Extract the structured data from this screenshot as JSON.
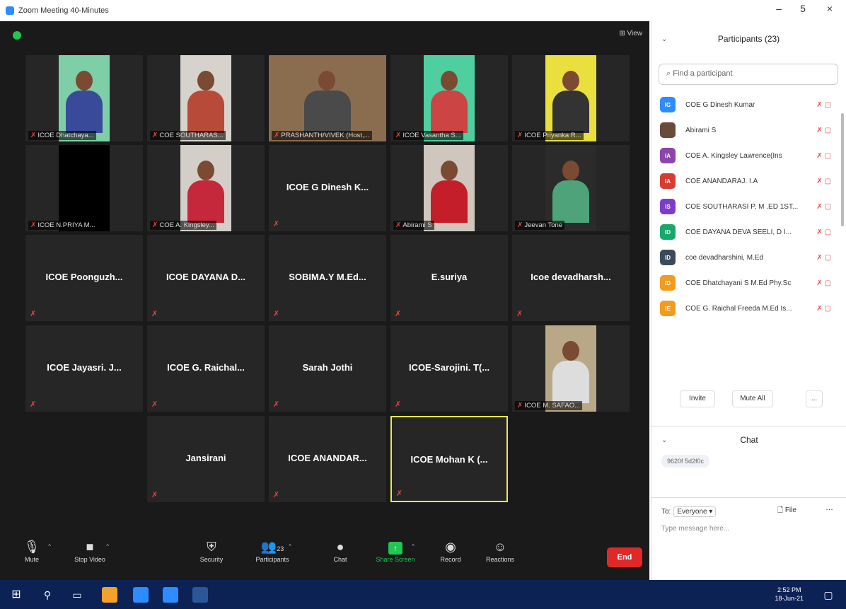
{
  "window": {
    "title": "Zoom Meeting 40-Minutes",
    "min": "–",
    "max": "5",
    "close": "×"
  },
  "meeting": {
    "view_label": "View"
  },
  "tiles": [
    {
      "label": "ICOE Dhatchaya...",
      "photo": true,
      "bg": "#7ecfa7",
      "shirt": "#3a4a9a"
    },
    {
      "label": "COE SOUTHARAS...",
      "photo": true,
      "bg": "#d7d3cc",
      "shirt": "#b84a3a"
    },
    {
      "label": "PRASHANTH/VIVEK (Host,...",
      "photo": true,
      "bg": "#8a6d4f",
      "shirt": "#4a4a4a",
      "wide": true
    },
    {
      "label": "ICOE Vasantha S...",
      "photo": true,
      "bg": "#4fcf9f",
      "shirt": "#c44"
    },
    {
      "label": "ICOE Priyanka R...",
      "photo": true,
      "bg": "#e9e040",
      "shirt": "#333"
    },
    {
      "label": "ICOE N.PRIYA M...",
      "photo": true,
      "bg": "#000",
      "shirt": "#000"
    },
    {
      "label": "COE A. Kingsley...",
      "photo": true,
      "bg": "#d3cfc8",
      "shirt": "#c4283a"
    },
    {
      "name": "ICOE G Dinesh K..."
    },
    {
      "label": "Abirami S",
      "photo": true,
      "bg": "#cfc6bd",
      "shirt": "#c41e2a"
    },
    {
      "label": "Jeevan Tone",
      "photo": true,
      "bg": "#2b2b2b",
      "shirt": "#4fa37a"
    },
    {
      "name": "ICOE Poonguzh..."
    },
    {
      "name": "ICOE DAYANA D..."
    },
    {
      "name": "SOBIMA.Y M.Ed..."
    },
    {
      "name": "E.suriya"
    },
    {
      "name": "Icoe devadharsh..."
    },
    {
      "name": "ICOE Jayasri. J..."
    },
    {
      "name": "ICOE G. Raichal..."
    },
    {
      "name": "Sarah Jothi"
    },
    {
      "name": "ICOE-Sarojini. T(..."
    },
    {
      "label": "ICOE M. SAFAO...",
      "photo": true,
      "bg": "#b9a888",
      "shirt": "#ddd"
    },
    {
      "name": "Jansirani"
    },
    {
      "name": "ICOE ANANDAR..."
    },
    {
      "name": "ICOE Mohan K (..."
    }
  ],
  "toolbar": {
    "mute": "Mute",
    "video": "Stop Video",
    "security": "Security",
    "participants": "Participants",
    "participant_count": "23",
    "chat": "Chat",
    "share": "Share Screen",
    "record": "Record",
    "reactions": "Reactions",
    "end": "End"
  },
  "panel": {
    "title": "Participants (23)",
    "search_placeholder": "Find a participant",
    "participants": [
      {
        "initials": "IG",
        "color": "#2d8cff",
        "name": "COE G Dinesh Kumar"
      },
      {
        "initials": "",
        "color": "#6a4a3a",
        "name": "Abirami S"
      },
      {
        "initials": "IA",
        "color": "#8e44ad",
        "name": "COE A. Kingsley Lawrence(Ins"
      },
      {
        "initials": "IA",
        "color": "#d63c2f",
        "name": "COE ANANDARAJ. I.A"
      },
      {
        "initials": "IS",
        "color": "#7d3cc9",
        "name": "COE SOUTHARASI P, M .ED 1ST..."
      },
      {
        "initials": "ID",
        "color": "#18a86b",
        "name": "COE DAYANA DEVA SEELI, D I..."
      },
      {
        "initials": "ID",
        "color": "#3a4a5a",
        "name": "coe devadharshini, M.Ed"
      },
      {
        "initials": "ID",
        "color": "#f29c1f",
        "name": "COE Dhatchayani S M.Ed Phy.Sc"
      },
      {
        "initials": "IE",
        "color": "#f29c1f",
        "name": "COE G. Raichal Freeda M.Ed Is..."
      }
    ],
    "invite": "Invite",
    "mute_all": "Mute All",
    "more": "...",
    "chat_title": "Chat",
    "chat_message": "9620f 5d2f0c",
    "to_label": "To:",
    "to_value": "Everyone",
    "file": "File",
    "type_placeholder": "Type message here..."
  },
  "taskbar": {
    "time": "2:52 PM",
    "date": "18-Jun-21"
  }
}
